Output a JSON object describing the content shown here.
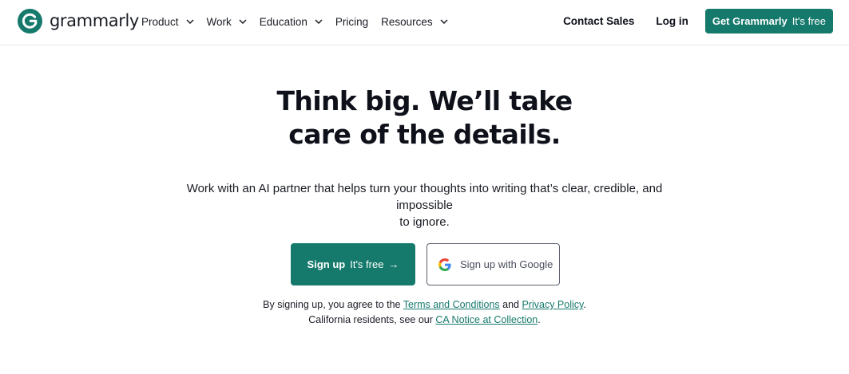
{
  "header": {
    "logo_text": "grammarly",
    "nav": [
      {
        "label": "Product",
        "has_dropdown": true
      },
      {
        "label": "Work",
        "has_dropdown": true
      },
      {
        "label": "Education",
        "has_dropdown": true
      },
      {
        "label": "Pricing",
        "has_dropdown": false
      },
      {
        "label": "Resources",
        "has_dropdown": true
      }
    ],
    "contact_sales": "Contact Sales",
    "login": "Log in",
    "get_button": {
      "strong": "Get Grammarly",
      "light": "It's free"
    }
  },
  "hero": {
    "title_line1": "Think big. We’ll take",
    "title_line2": "care of the details.",
    "subtitle_line1": "Work with an AI partner that helps turn your thoughts into writing that’s clear, credible, and impossible",
    "subtitle_line2": "to ignore."
  },
  "cta": {
    "signup_strong": "Sign up",
    "signup_light": "It's free",
    "signup_arrow": "→",
    "google_label": "Sign up with Google"
  },
  "legal": {
    "prefix": "By signing up, you agree to the ",
    "terms": "Terms and Conditions",
    "and": " and ",
    "privacy": "Privacy Policy",
    "period1": ".",
    "ca_prefix": "California residents, see our ",
    "ca_notice": "CA Notice at Collection",
    "period2": "."
  },
  "colors": {
    "brand_green": "#15796b",
    "text_dark": "#0e101a",
    "border": "#e3e5e8"
  },
  "icons": {
    "logo": "grammarly-logo-icon",
    "chevron": "chevron-down-icon",
    "google": "google-g-icon",
    "arrow": "arrow-right-icon"
  }
}
